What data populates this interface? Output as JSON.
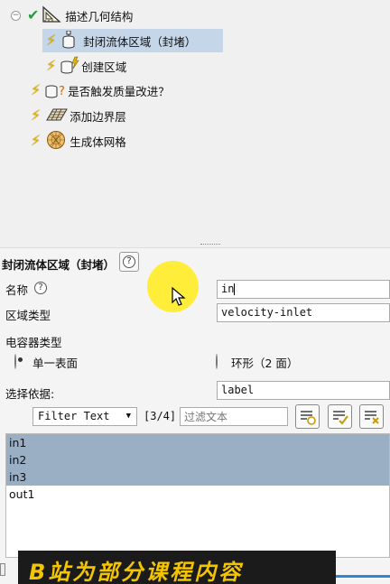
{
  "tree": {
    "items": [
      {
        "label": "描述几何结构"
      },
      {
        "label": "封闭流体区域（封堵）"
      },
      {
        "label": "创建区域"
      },
      {
        "label": "是否触发质量改进？"
      },
      {
        "label": "添加边界层"
      },
      {
        "label": "生成体网格"
      }
    ]
  },
  "form": {
    "title": "封闭流体区域（封堵）",
    "name_label": "名称",
    "name_value": "in",
    "region_type_label": "区域类型",
    "region_type_value": "velocity-inlet",
    "capacitor_type_label": "电容器类型",
    "option_single": "单一表面",
    "option_ring": "环形（2 面）",
    "selection_label": "选择依据:",
    "selection_value": "label",
    "filter_select": "Filter Text",
    "count": "[3/4]",
    "filter_placeholder": "过滤文本",
    "list": [
      "in1",
      "in2",
      "in3",
      "out1"
    ]
  },
  "overlay": {
    "watermark": "B站为部分课程内容"
  },
  "colors": {
    "selected_row": "#c5d6e9",
    "list_selection": "#9aaec4",
    "cursor_highlight": "#ffec28",
    "watermark_text": "#f3c400"
  }
}
